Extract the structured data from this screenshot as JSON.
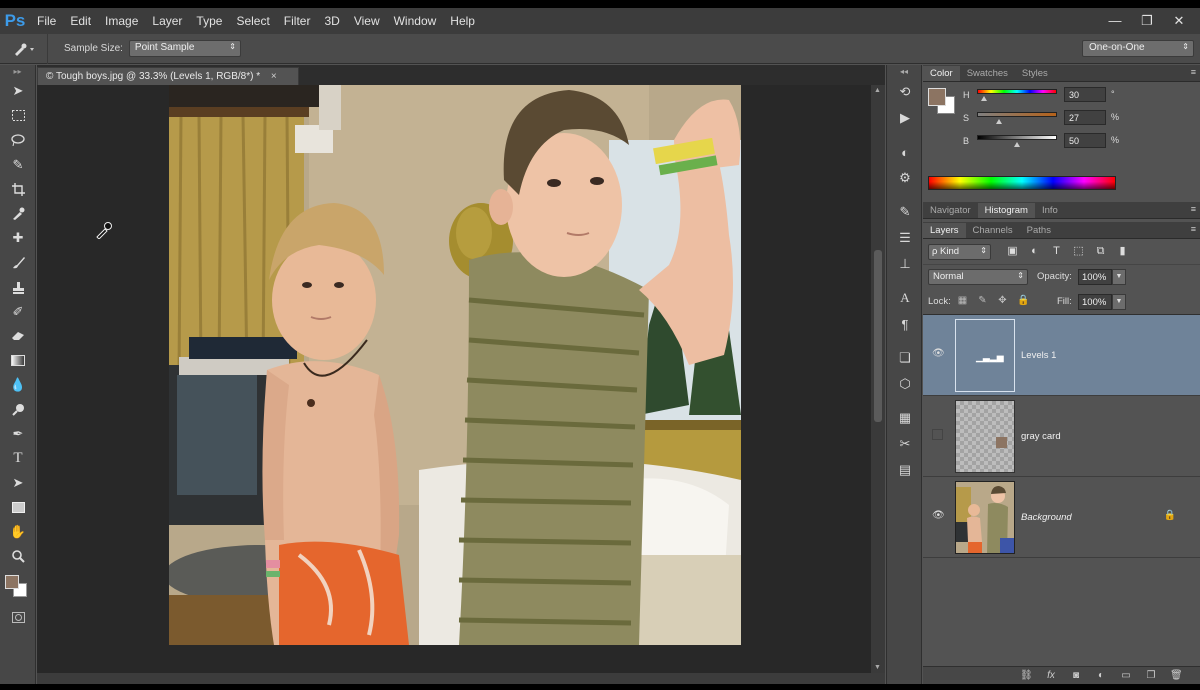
{
  "app": {
    "logo": "Ps"
  },
  "menu": [
    "File",
    "Edit",
    "Image",
    "Layer",
    "Type",
    "Select",
    "Filter",
    "3D",
    "View",
    "Window",
    "Help"
  ],
  "window_controls": {
    "minimize": "—",
    "restore": "❐",
    "close": "✕"
  },
  "options": {
    "sample_size_label": "Sample Size:",
    "sample_size_value": "Point Sample",
    "workspace": "One-on-One"
  },
  "document": {
    "tab_title": "© Tough boys.jpg @ 33.3% (Levels 1, RGB/8*) *",
    "tab_close": "×"
  },
  "color_panel": {
    "tabs": [
      "Color",
      "Swatches",
      "Styles"
    ],
    "active_tab": "Color",
    "fg_color": "#8c7462",
    "bg_color": "#ffffff",
    "rows": [
      {
        "label": "H",
        "value": "30",
        "unit": "°"
      },
      {
        "label": "S",
        "value": "27",
        "unit": "%"
      },
      {
        "label": "B",
        "value": "50",
        "unit": "%"
      }
    ],
    "h_fraction": 0.083,
    "s_fraction": 0.27,
    "b_fraction": 0.5
  },
  "nav_panel": {
    "tabs": [
      "Navigator",
      "Histogram",
      "Info"
    ],
    "active_tab": "Histogram"
  },
  "layers_panel": {
    "tabs": [
      "Layers",
      "Channels",
      "Paths"
    ],
    "active_tab": "Layers",
    "kind": "ρ Kind",
    "blend_mode": "Normal",
    "opacity_label": "Opacity:",
    "opacity": "100%",
    "lock_label": "Lock:",
    "fill_label": "Fill:",
    "fill": "100%",
    "layers": [
      {
        "name": "Levels 1",
        "type": "adjustment",
        "visible": true,
        "selected": true
      },
      {
        "name": "gray card",
        "type": "checker",
        "visible": false,
        "selected": false
      },
      {
        "name": "Background",
        "type": "photo",
        "visible": true,
        "selected": false,
        "locked": true
      }
    ]
  },
  "icons": {
    "tools": [
      "move-tool-icon",
      "marquee-tool-icon",
      "lasso-tool-icon",
      "quick-select-tool-icon",
      "crop-tool-icon",
      "eyedropper-tool-icon",
      "healing-brush-tool-icon",
      "brush-tool-icon",
      "clone-stamp-tool-icon",
      "history-brush-tool-icon",
      "eraser-tool-icon",
      "gradient-tool-icon",
      "blur-tool-icon",
      "dodge-tool-icon",
      "pen-tool-icon",
      "type-tool-icon",
      "path-select-tool-icon",
      "shape-tool-icon",
      "hand-tool-icon",
      "zoom-tool-icon"
    ]
  }
}
